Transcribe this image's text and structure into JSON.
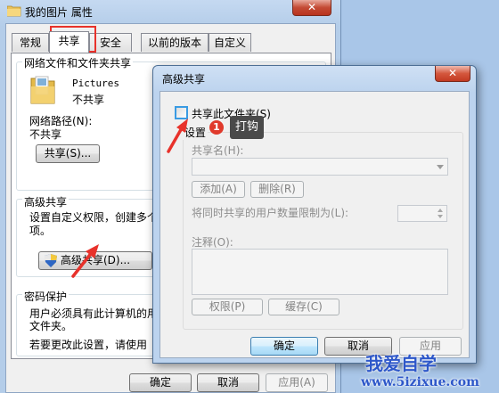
{
  "properties_window": {
    "title": "我的图片 属性",
    "close_glyph": "✕",
    "tabs": [
      "常规",
      "共享",
      "安全",
      "以前的版本",
      "自定义"
    ],
    "active_tab": "共享",
    "network_section": {
      "title": "网络文件和文件夹共享",
      "folder_name": "Pictures",
      "folder_status": "不共享",
      "network_path_label": "网络路径(N):",
      "network_path_value": "不共享",
      "share_button": "共享(S)..."
    },
    "advanced_section": {
      "title": "高级共享",
      "description_line1": "设置自定义权限，创建多个",
      "description_line2": "项。",
      "advanced_button": "高级共享(D)..."
    },
    "password_section": {
      "title": "密码保护",
      "line1": "用户必须具有此计算机的用",
      "line2": "文件夹。",
      "line3": "若要更改此设置，请使用"
    },
    "buttons": {
      "ok": "确定",
      "cancel": "取消",
      "apply": "应用(A)"
    }
  },
  "advanced_dialog": {
    "title": "高级共享",
    "close_glyph": "✕",
    "share_checkbox_label": "共享此文件夹(S)",
    "share_checkbox_checked": false,
    "settings_group_title": "设置",
    "share_name_label": "共享名(H):",
    "share_name_value": "",
    "add_button": "添加(A)",
    "remove_button": "删除(R)",
    "user_limit_label": "将同时共享的用户数量限制为(L):",
    "user_limit_value": "",
    "comment_label": "注释(O):",
    "comment_value": "",
    "permissions_button": "权限(P)",
    "caching_button": "缓存(C)",
    "ok_button": "确定",
    "cancel_button": "取消",
    "apply_button": "应用"
  },
  "annotation": {
    "step_number": "1",
    "tooltip_text": "打钩",
    "highlight_color": "#e8322b"
  },
  "watermark": {
    "line1": "我爱自学",
    "line2": "www.5izixue.com"
  }
}
